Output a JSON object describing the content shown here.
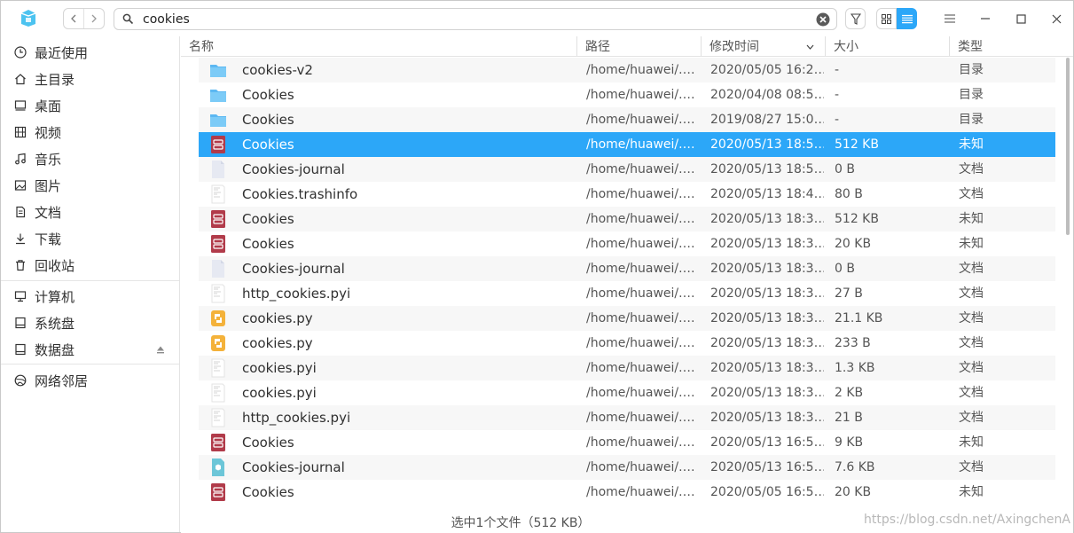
{
  "search": {
    "value": "cookies",
    "placeholder": ""
  },
  "nav": {
    "back_icon": "chevron-left-icon",
    "forward_icon": "chevron-right-icon"
  },
  "colors": {
    "accent": "#2ca7f8",
    "selection": "#2ca7f8",
    "folder": "#4cb2f5",
    "db_icon": "#b23a48",
    "python_icon": "#f4b23a"
  },
  "sidebar": {
    "items": [
      {
        "label": "最近使用",
        "icon": "clock-icon"
      },
      {
        "label": "主目录",
        "icon": "home-icon"
      },
      {
        "label": "桌面",
        "icon": "desktop-icon"
      },
      {
        "label": "视频",
        "icon": "video-icon"
      },
      {
        "label": "音乐",
        "icon": "music-icon"
      },
      {
        "label": "图片",
        "icon": "picture-icon"
      },
      {
        "label": "文档",
        "icon": "document-icon"
      },
      {
        "label": "下载",
        "icon": "download-icon"
      },
      {
        "label": "回收站",
        "icon": "trash-icon"
      },
      {
        "label": "计算机",
        "icon": "computer-icon"
      },
      {
        "label": "系统盘",
        "icon": "disk-icon"
      },
      {
        "label": "数据盘",
        "icon": "disk-icon"
      },
      {
        "label": "网络邻居",
        "icon": "network-icon"
      }
    ]
  },
  "columns": {
    "name": "名称",
    "path": "路径",
    "time": "修改时间",
    "size": "大小",
    "type": "类型"
  },
  "files": [
    {
      "name": "cookies-v2",
      "path": "/home/huawei/.…",
      "time": "2020/05/05 16:2…",
      "size": "-",
      "type": "目录",
      "icon": "folder-icon"
    },
    {
      "name": "Cookies",
      "path": "/home/huawei/.…",
      "time": "2020/04/08 08:5…",
      "size": "-",
      "type": "目录",
      "icon": "folder-icon"
    },
    {
      "name": "Cookies",
      "path": "/home/huawei/.…",
      "time": "2019/08/27 15:0…",
      "size": "-",
      "type": "目录",
      "icon": "folder-icon"
    },
    {
      "name": "Cookies",
      "path": "/home/huawei/.…",
      "time": "2020/05/13 18:5…",
      "size": "512 KB",
      "type": "未知",
      "icon": "database-file-icon",
      "selected": true
    },
    {
      "name": "Cookies-journal",
      "path": "/home/huawei/.…",
      "time": "2020/05/13 18:5…",
      "size": "0 B",
      "type": "文档",
      "icon": "blank-file-icon"
    },
    {
      "name": "Cookies.trashinfo",
      "path": "/home/huawei/.…",
      "time": "2020/05/13 18:4…",
      "size": "80 B",
      "type": "文档",
      "icon": "text-file-icon"
    },
    {
      "name": "Cookies",
      "path": "/home/huawei/.…",
      "time": "2020/05/13 18:3…",
      "size": "512 KB",
      "type": "未知",
      "icon": "database-file-icon"
    },
    {
      "name": "Cookies",
      "path": "/home/huawei/.…",
      "time": "2020/05/13 18:3…",
      "size": "20 KB",
      "type": "未知",
      "icon": "database-file-icon"
    },
    {
      "name": "Cookies-journal",
      "path": "/home/huawei/.…",
      "time": "2020/05/13 18:3…",
      "size": "0 B",
      "type": "文档",
      "icon": "blank-file-icon"
    },
    {
      "name": "http_cookies.pyi",
      "path": "/home/huawei/.…",
      "time": "2020/05/13 18:3…",
      "size": "27 B",
      "type": "文档",
      "icon": "text-file-icon"
    },
    {
      "name": "cookies.py",
      "path": "/home/huawei/.…",
      "time": "2020/05/13 18:3…",
      "size": "21.1 KB",
      "type": "文档",
      "icon": "python-file-icon"
    },
    {
      "name": "cookies.py",
      "path": "/home/huawei/.…",
      "time": "2020/05/13 18:3…",
      "size": "233 B",
      "type": "文档",
      "icon": "python-file-icon"
    },
    {
      "name": "cookies.pyi",
      "path": "/home/huawei/.…",
      "time": "2020/05/13 18:3…",
      "size": "1.3 KB",
      "type": "文档",
      "icon": "text-file-icon"
    },
    {
      "name": "cookies.pyi",
      "path": "/home/huawei/.…",
      "time": "2020/05/13 18:3…",
      "size": "2 KB",
      "type": "文档",
      "icon": "text-file-icon"
    },
    {
      "name": "http_cookies.pyi",
      "path": "/home/huawei/.…",
      "time": "2020/05/13 18:3…",
      "size": "21 B",
      "type": "文档",
      "icon": "text-file-icon"
    },
    {
      "name": "Cookies",
      "path": "/home/huawei/.…",
      "time": "2020/05/13 16:5…",
      "size": "9 KB",
      "type": "未知",
      "icon": "database-file-icon"
    },
    {
      "name": "Cookies-journal",
      "path": "/home/huawei/.…",
      "time": "2020/05/13 16:5…",
      "size": "7.6 KB",
      "type": "文档",
      "icon": "package-file-icon"
    },
    {
      "name": "Cookies",
      "path": "/home/huawei/.…",
      "time": "2020/05/05 16:5…",
      "size": "20 KB",
      "type": "未知",
      "icon": "database-file-icon"
    }
  ],
  "status": {
    "text": "选中1个文件（512 KB）"
  },
  "watermark": "https://blog.csdn.net/AxingchenA"
}
